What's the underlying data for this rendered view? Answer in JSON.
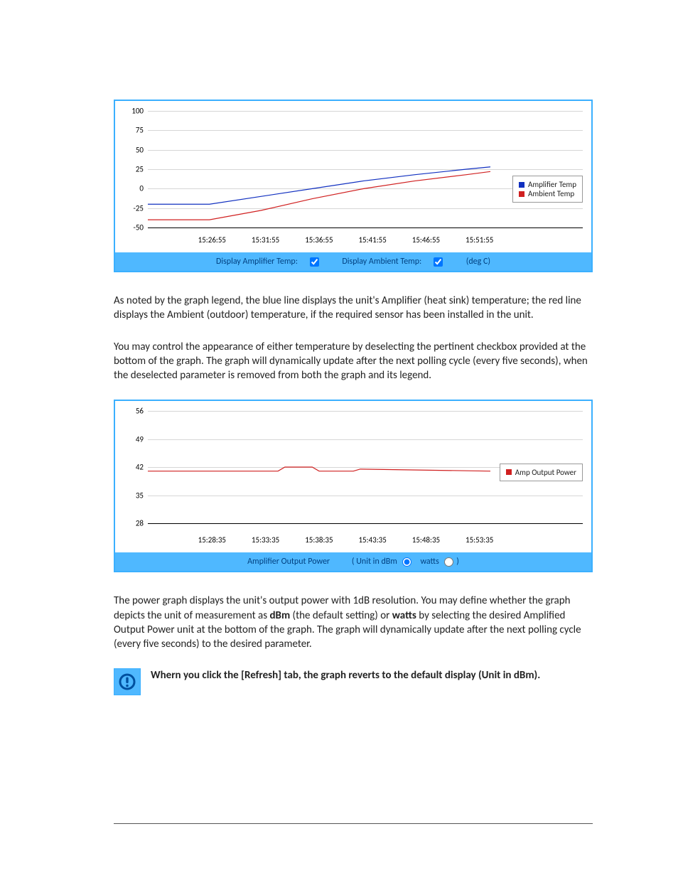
{
  "chart_data": [
    {
      "type": "line",
      "title": "",
      "xlabel": "",
      "ylabel": "",
      "ylim": [
        -60,
        100
      ],
      "yticks": [
        -50,
        -25,
        0,
        25,
        50,
        75,
        100
      ],
      "categories": [
        "15:26:55",
        "15:31:55",
        "15:36:55",
        "15:41:55",
        "15:46:55",
        "15:51:55"
      ],
      "xpos_pct": [
        18,
        33,
        48,
        63,
        78,
        93
      ],
      "series": [
        {
          "name": "Amplifier Temp",
          "color": "#1130c0",
          "x": [
            0,
            5,
            18,
            33,
            48,
            63,
            78,
            93,
            100
          ],
          "values": [
            -20,
            -20,
            -20,
            -10,
            0,
            10,
            18,
            25,
            28
          ]
        },
        {
          "name": "Ambient Temp",
          "color": "#d02020",
          "x": [
            0,
            5,
            18,
            33,
            48,
            63,
            78,
            93,
            100
          ],
          "values": [
            -40,
            -40,
            -40,
            -28,
            -13,
            0,
            10,
            18,
            22
          ]
        }
      ],
      "legend": [
        "Amplifier Temp",
        "Ambient Temp"
      ],
      "controls": {
        "display_amplifier_label": "Display Amplifier Temp:",
        "display_ambient_label": "Display Ambient Temp:",
        "units_label": "(deg C)"
      }
    },
    {
      "type": "line",
      "title": "",
      "xlabel": "",
      "ylabel": "",
      "ylim": [
        25,
        56
      ],
      "yticks": [
        28,
        35,
        42,
        49,
        56
      ],
      "categories": [
        "15:28:35",
        "15:33:35",
        "15:38:35",
        "15:43:35",
        "15:48:35",
        "15:53:35"
      ],
      "xpos_pct": [
        18,
        33,
        48,
        63,
        78,
        93
      ],
      "series": [
        {
          "name": "Amp Output Power",
          "color": "#d02020",
          "x": [
            0,
            38,
            40,
            48,
            50,
            60,
            62,
            100
          ],
          "values": [
            41,
            41,
            42,
            42,
            41,
            41,
            41.5,
            41
          ]
        }
      ],
      "legend": [
        "Amp Output Power"
      ],
      "controls": {
        "title_label": "Amplifier Output Power",
        "unit_prefix": "( Unit in dBm",
        "watts_label": "watts",
        "suffix": ")"
      }
    }
  ],
  "text": {
    "para1": "As noted by the graph legend, the blue line displays the unit's Amplifier (heat sink) temperature; the red line displays the Ambient (outdoor) temperature, if the required sensor has been installed in the unit.",
    "para2": "You may control the appearance of either temperature by deselecting the pertinent checkbox provided at the bottom of the graph. The graph will dynamically update after the next polling cycle (every five seconds), when the deselected parameter is removed from both the graph and its legend.",
    "para3a": "The power graph displays the unit's output power with 1dB resolution. You may define whether the graph depicts the unit of measurement as ",
    "para3_b1": "dBm",
    "para3b": " (the default setting) or ",
    "para3_b2": "watts",
    "para3c": " by selecting the desired Amplified Output Power unit at the bottom of the graph. The graph will dynamically update after the next polling cycle (every five seconds) to the desired parameter.",
    "note": "Whern you click the [Refresh] tab, the graph reverts to the default display (Unit in dBm)."
  }
}
